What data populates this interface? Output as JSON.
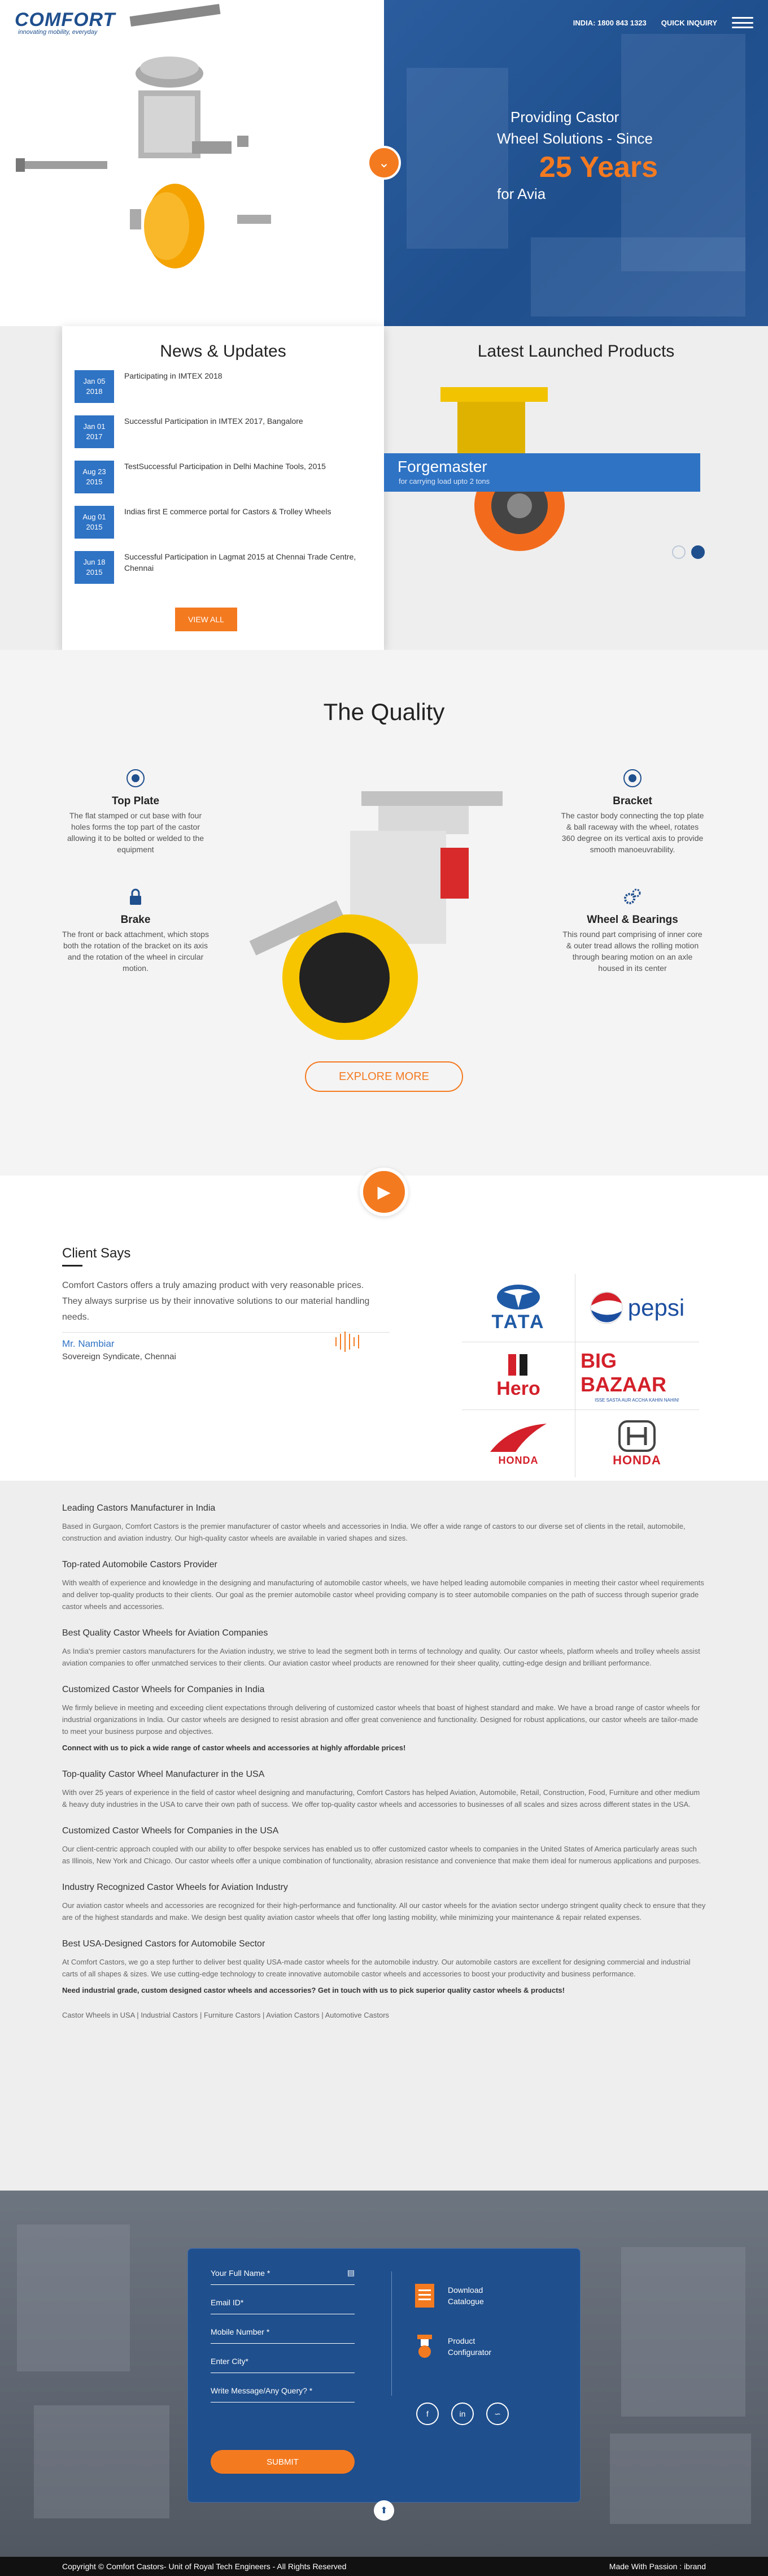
{
  "brand": {
    "name": "COMFORT",
    "tagline": "innovating mobility, everyday"
  },
  "nav": {
    "phone": "INDIA: 1800 843 1323",
    "quick": "QUICK INQUIRY"
  },
  "hero": {
    "line1": "Providing Castor",
    "line2": "Wheel Solutions - Since",
    "years": "25 Years",
    "line3": "for Avia"
  },
  "news": {
    "title": "News & Updates",
    "view_all": "VIEW ALL",
    "items": [
      {
        "date1": "Jan 05",
        "date2": "2018",
        "text": "Participating in IMTEX 2018"
      },
      {
        "date1": "Jan 01",
        "date2": "2017",
        "text": "Successful Participation in IMTEX 2017, Bangalore"
      },
      {
        "date1": "Aug 23",
        "date2": "2015",
        "text": "TestSuccessful Participation in Delhi Machine Tools, 2015"
      },
      {
        "date1": "Aug 01",
        "date2": "2015",
        "text": "Indias first E commerce portal for Castors & Trolley Wheels"
      },
      {
        "date1": "Jun 18",
        "date2": "2015",
        "text": "Successful Participation in Lagmat 2015 at Chennai Trade Centre, Chennai"
      }
    ]
  },
  "products": {
    "title": "Latest Launched Products",
    "name": "Forgemaster",
    "desc": "for carrying load upto 2 tons"
  },
  "quality": {
    "title": "The Quality",
    "explore": "EXPLORE MORE",
    "items": [
      {
        "title": "Top Plate",
        "text": "The flat stamped or cut base with four holes forms the top part of the castor allowing it to be bolted or welded to the equipment"
      },
      {
        "title": "Bracket",
        "text": "The castor body connecting the top plate & ball raceway with the wheel, rotates 360 degree on its vertical axis to provide smooth manoeuvrability."
      },
      {
        "title": "Brake",
        "text": "The front or back attachment, which stops both the rotation of the bracket on its axis and the rotation of the wheel in circular motion."
      },
      {
        "title": "Wheel & Bearings",
        "text": "This round part comprising of inner core & outer tread allows the rolling motion through bearing motion on an axle housed in its center"
      }
    ]
  },
  "clients": {
    "title": "Client Says",
    "quote": "Comfort Castors offers a truly amazing product with very reasonable prices. They always surprise us by their innovative solutions to our material handling needs.",
    "name": "Mr. Nambiar",
    "org": "Sovereign Syndicate, Chennai",
    "logos": [
      "TATA",
      "pepsi",
      "Hero",
      "BIG BAZAAR",
      "HONDA",
      "HONDA"
    ],
    "bigbazaar_tag": "ISSE SASTA AUR ACCHA KAHIN NAHIN!"
  },
  "seo": {
    "sections": [
      {
        "h": "Leading Castors Manufacturer in India",
        "p": "Based in Gurgaon, Comfort Castors is the premier manufacturer of castor wheels and accessories in India. We offer a wide range of castors to our diverse set of clients in the retail, automobile, construction and aviation industry. Our high-quality castor wheels are available in varied shapes and sizes."
      },
      {
        "h": "Top-rated Automobile Castors Provider",
        "p": "With wealth of experience and knowledge in the designing and manufacturing of automobile castor wheels, we have helped leading automobile companies in meeting their castor wheel requirements and deliver top-quality products to their clients. Our goal as the premier automobile castor wheel providing company is to steer automobile companies on the path of success through superior grade castor wheels and accessories."
      },
      {
        "h": "Best Quality Castor Wheels for Aviation Companies",
        "p": "As India's premier castors manufacturers for the Aviation industry, we strive to lead the segment both in terms of technology and quality. Our castor wheels, platform wheels and trolley wheels assist aviation companies to offer unmatched services to their clients. Our aviation castor wheel products are renowned for their sheer quality, cutting-edge design and brilliant performance."
      },
      {
        "h": "Customized Castor Wheels for Companies in India",
        "p": "We firmly believe in meeting and exceeding client expectations through delivering of customized castor wheels that boast of highest standard and make. We have a broad range of castor wheels for industrial organizations in India. Our castor wheels are designed to resist abrasion and offer great convenience and functionality. Designed for robust applications, our castor wheels are tailor-made to meet your business purpose and objectives.",
        "bold": "Connect with us to pick a wide range of castor wheels and accessories at highly affordable prices!"
      },
      {
        "h": "Top-quality Castor Wheel Manufacturer in the USA",
        "p": "With over 25 years of experience in the field of castor wheel designing and manufacturing, Comfort Castors has helped Aviation, Automobile, Retail, Construction, Food, Furniture and other medium & heavy duty industries in the USA to carve their own path of success. We offer top-quality castor wheels and accessories to businesses of all scales and sizes across different states in the USA."
      },
      {
        "h": "Customized Castor Wheels for Companies in the USA",
        "p": "Our client-centric approach coupled with our ability to offer bespoke services has enabled us to offer customized castor wheels to companies in the United States of America particularly areas such as Illinois, New York and Chicago. Our castor wheels offer a unique combination of functionality, abrasion resistance and convenience that make them ideal for numerous applications and purposes."
      },
      {
        "h": "Industry Recognized Castor Wheels for Aviation Industry",
        "p": "Our aviation castor wheels and accessories are recognized for their high-performance and functionality. All our castor wheels for the aviation sector undergo stringent quality check to ensure that they are of the highest standards and make. We design best quality aviation castor wheels that offer long lasting mobility, while minimizing your maintenance & repair related expenses."
      },
      {
        "h": "Best USA-Designed Castors for Automobile Sector",
        "p": "At Comfort Castors, we go a step further to deliver best quality USA-made castor wheels for the automobile industry. Our automobile castors are excellent for designing commercial and industrial carts of all shapes & sizes. We use cutting-edge technology to create innovative automobile castor wheels and accessories to boost your productivity and business performance.",
        "bold": "Need industrial grade, custom designed castor wheels and accessories? Get in touch with us to pick superior quality castor wheels & products!"
      }
    ],
    "links": [
      "Castor Wheels in USA",
      "Industrial Castors",
      "Furniture Castors",
      "Aviation Castors",
      "Automotive Castors"
    ]
  },
  "form": {
    "name": "Your Full Name *",
    "email": "Email ID*",
    "mobile": "Mobile Number *",
    "city": "Enter City*",
    "message": "Write Message/Any Query? *",
    "submit": "SUBMIT"
  },
  "downloads": {
    "catalogue1": "Download",
    "catalogue2": "Catalogue",
    "config1": "Product",
    "config2": "Configurator"
  },
  "footer": {
    "copy": "Copyright © Comfort Castors- Unit of Royal Tech Engineers - All Rights Reserved",
    "made": "Made With Passion : ibrand"
  },
  "colors": {
    "blue": "#1f4f8d",
    "accent": "#f47a20",
    "light_blue": "#2f73c4"
  }
}
